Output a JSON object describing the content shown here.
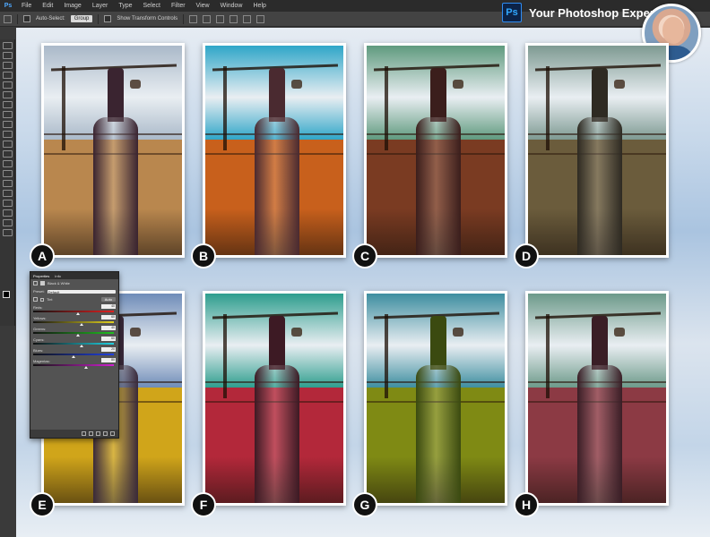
{
  "menu": {
    "app_icon": "Ps",
    "items": [
      "File",
      "Edit",
      "Image",
      "Layer",
      "Type",
      "Select",
      "Filter",
      "View",
      "Window",
      "Help"
    ]
  },
  "options_bar": {
    "auto_select_label": "Auto-Select:",
    "auto_select_value": "Group",
    "show_transform_label": "Show Transform Controls"
  },
  "brand": {
    "logo": "Ps",
    "title": "Your Photoshop Expert"
  },
  "photos": [
    {
      "letter": "A",
      "sky": "#aab9c9",
      "ground": "#b9874e",
      "bottle": "#3a2430",
      "tint": "rgba(0,0,0,0)"
    },
    {
      "letter": "B",
      "sky": "#2fa6c8",
      "ground": "#c8601c",
      "bottle": "#4a2a30",
      "tint": "rgba(0,0,0,0)"
    },
    {
      "letter": "C",
      "sky": "#5f9a7e",
      "ground": "#7a3b22",
      "bottle": "#3b1e1c",
      "tint": "rgba(0,0,0,0)"
    },
    {
      "letter": "D",
      "sky": "#7e9a92",
      "ground": "#6b5c3c",
      "bottle": "#2e2a22",
      "tint": "rgba(0,0,0,0)"
    },
    {
      "letter": "E",
      "sky": "#6f8cb8",
      "ground": "#d0a51a",
      "bottle": "#3a2a3a",
      "tint": "rgba(0,0,0,0)"
    },
    {
      "letter": "F",
      "sky": "#2e9e8e",
      "ground": "#b3283a",
      "bottle": "#3d1a24",
      "tint": "rgba(0,0,0,0)"
    },
    {
      "letter": "G",
      "sky": "#3e8ea0",
      "ground": "#7f8a14",
      "bottle": "#3b4a10",
      "tint": "rgba(0,0,0,0)"
    },
    {
      "letter": "H",
      "sky": "#6d9a8a",
      "ground": "#8c3a44",
      "bottle": "#3a1e26",
      "tint": "rgba(0,0,0,0)"
    }
  ],
  "properties_panel": {
    "tab_properties": "Properties",
    "tab_info": "Info",
    "adjustment_title": "Black & White",
    "preset_label": "Preset:",
    "preset_value": "Default",
    "tint_label": "Tint",
    "auto_label": "Auto",
    "sliders": [
      {
        "label": "Reds:",
        "value": "40",
        "gradient": "linear-gradient(90deg,#111,#e02020)",
        "fraction": 0.55
      },
      {
        "label": "Yellows:",
        "value": "60",
        "gradient": "linear-gradient(90deg,#111,#e0d020)",
        "fraction": 0.6
      },
      {
        "label": "Greens:",
        "value": "40",
        "gradient": "linear-gradient(90deg,#111,#20c020)",
        "fraction": 0.55
      },
      {
        "label": "Cyans:",
        "value": "60",
        "gradient": "linear-gradient(90deg,#111,#20d0e0)",
        "fraction": 0.6
      },
      {
        "label": "Blues:",
        "value": "20",
        "gradient": "linear-gradient(90deg,#111,#2040e0)",
        "fraction": 0.5
      },
      {
        "label": "Magentas:",
        "value": "80",
        "gradient": "linear-gradient(90deg,#111,#d020d0)",
        "fraction": 0.65
      }
    ]
  }
}
